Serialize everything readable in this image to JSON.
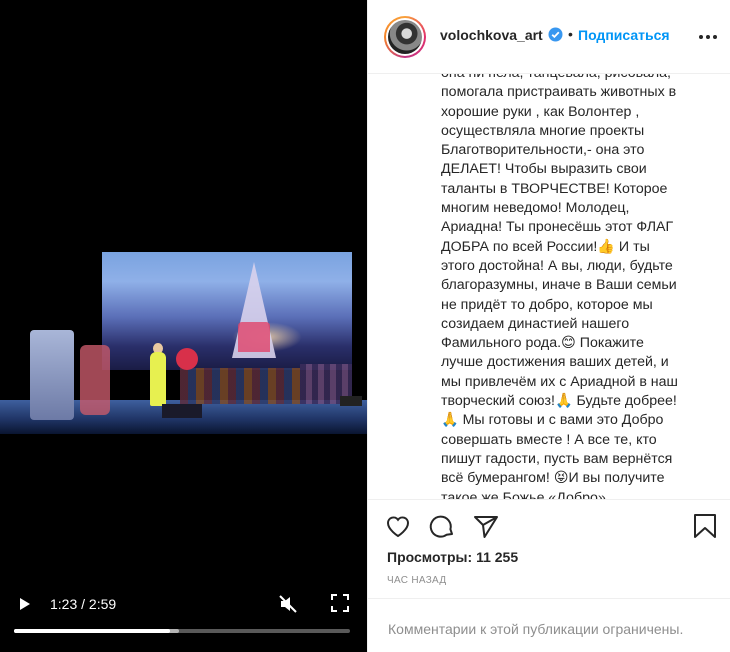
{
  "video": {
    "current_time": "1:23",
    "separator": " / ",
    "duration": "2:59",
    "progress_fraction": 0.463,
    "buffered_fraction": 0.49,
    "muted": true
  },
  "post": {
    "username": "volochkova_art",
    "verified": true,
    "bullet": "•",
    "follow_label": "Подписаться",
    "caption": "она ни пела, танцевала, рисовала,\nпомогала пристраивать животных в\nхорошие руки , как Волонтер ,\nосуществляла многие проекты\nБлаготворительности,- она это\nДЕЛАЕТ! Чтобы выразить свои\nталанты в ТВОРЧЕСТВЕ! Которое\nмногим неведомо! Молодец,\nАриадна! Ты пронесёшь этот ФЛАГ\nДОБРА по всей России!👍 И ты\nэтого достойна! А вы, люди, будьте\nблагоразумны, иначе в Ваши семьи\nне придёт то добро, которое мы\nсозидаем династией нашего\nФамильного рода.😊 Покажите\nлучше достижения ваших детей, и\nмы привлечём их с Ариадной в наш\nтворческий союз!🙏 Будьте добрее!\n🙏 Мы готовы и с вами это Добро\nсовершать вместе ! А все те, кто\nпишут гадости, пусть вам вернётся\nвсё бумерангом! 😝И вы получите\nтакое же Божье «Добро»",
    "views_label": "Просмотры:",
    "views_count": "11 255",
    "posted_time": "ЧАС НАЗАД",
    "comments_note": "Комментарии к этой публикации ограничены."
  },
  "icons": {
    "play": "play-icon",
    "mute": "speaker-muted-icon",
    "fullscreen": "fullscreen-icon",
    "verified": "verified-badge-icon",
    "more": "more-horizontal-icon",
    "like": "heart-icon",
    "comment": "comment-bubble-icon",
    "share": "paper-plane-icon",
    "save": "bookmark-icon"
  },
  "colors": {
    "accent": "#0095f6",
    "text": "#262626",
    "muted_text": "#8e8e8e",
    "video_bg": "#000000"
  }
}
